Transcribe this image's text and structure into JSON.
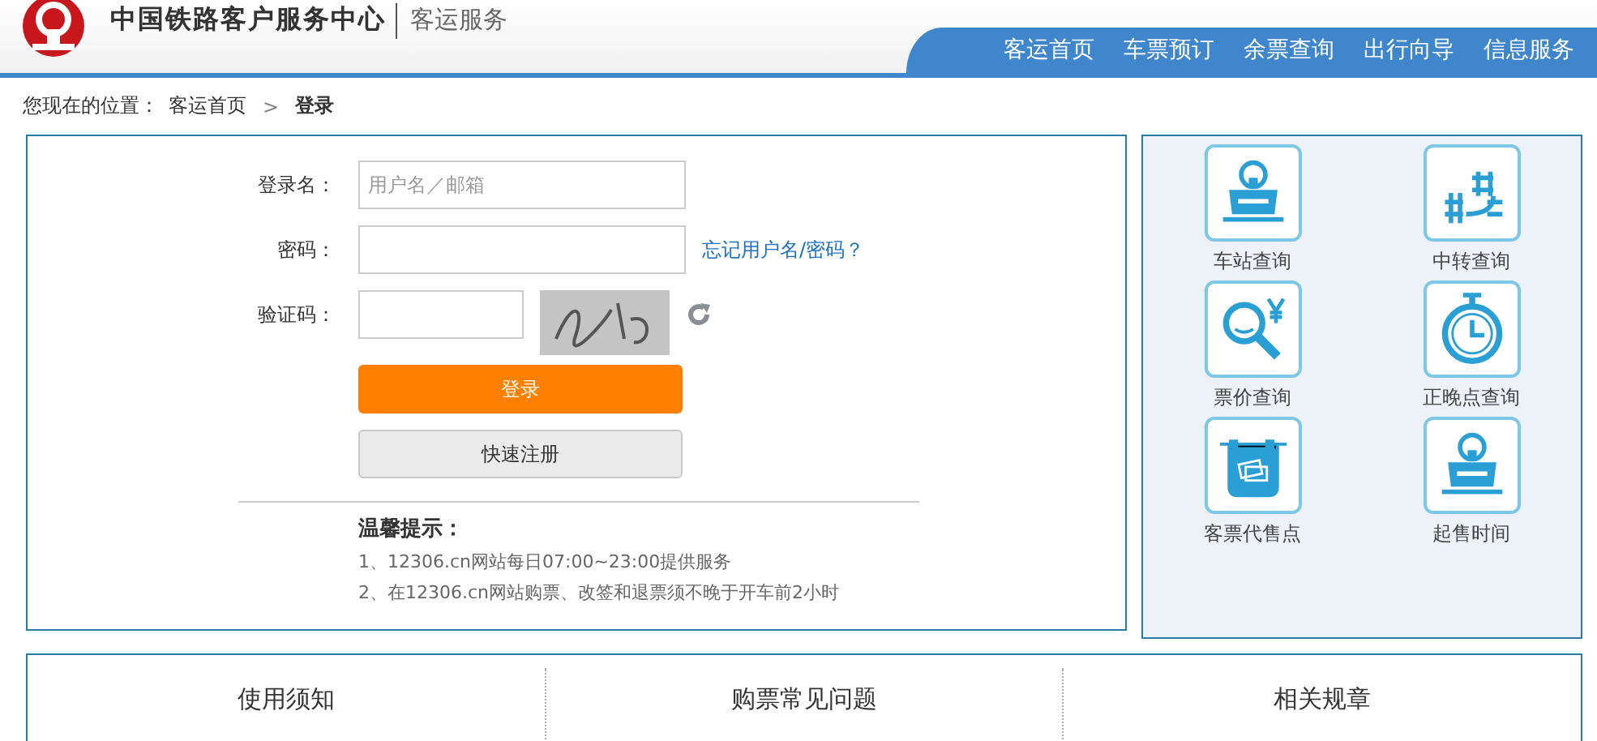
{
  "header": {
    "title": "中国铁路客户服务中心",
    "subtitle": "客运服务",
    "nav": [
      {
        "label": "客运首页"
      },
      {
        "label": "车票预订"
      },
      {
        "label": "余票查询"
      },
      {
        "label": "出行向导"
      },
      {
        "label": "信息服务"
      }
    ]
  },
  "breadcrumb": {
    "prefix": "您现在的位置：",
    "link": "客运首页",
    "separator": ">",
    "current": "登录"
  },
  "login": {
    "fields": [
      {
        "label": "登录名：",
        "placeholder": "用户名／邮箱",
        "kind": "text"
      },
      {
        "label": "密码：",
        "kind": "password",
        "link": "忘记用户名/密码？"
      },
      {
        "label": "验证码：",
        "kind": "captcha"
      }
    ],
    "buttons": [
      {
        "label": "登录",
        "kind": "primary"
      },
      {
        "label": "快速注册",
        "kind": "secondary"
      }
    ],
    "tips": {
      "title": "温馨提示：",
      "lines": [
        "1、12306.cn网站每日07:00~23:00提供服务",
        "2、在12306.cn网站购票、改签和退票须不晚于开车前2小时"
      ]
    }
  },
  "quick_links": [
    {
      "label": "车站查询",
      "kind": "station"
    },
    {
      "label": "中转查询",
      "kind": "transfer"
    },
    {
      "label": "票价查询",
      "kind": "price"
    },
    {
      "label": "正晚点查询",
      "kind": "clock"
    },
    {
      "label": "客票代售点",
      "kind": "ticket"
    },
    {
      "label": "起售时间",
      "kind": "station"
    }
  ],
  "sections": [
    {
      "title": "使用须知"
    },
    {
      "title": "购票常见问题"
    },
    {
      "title": "相关规章"
    }
  ]
}
